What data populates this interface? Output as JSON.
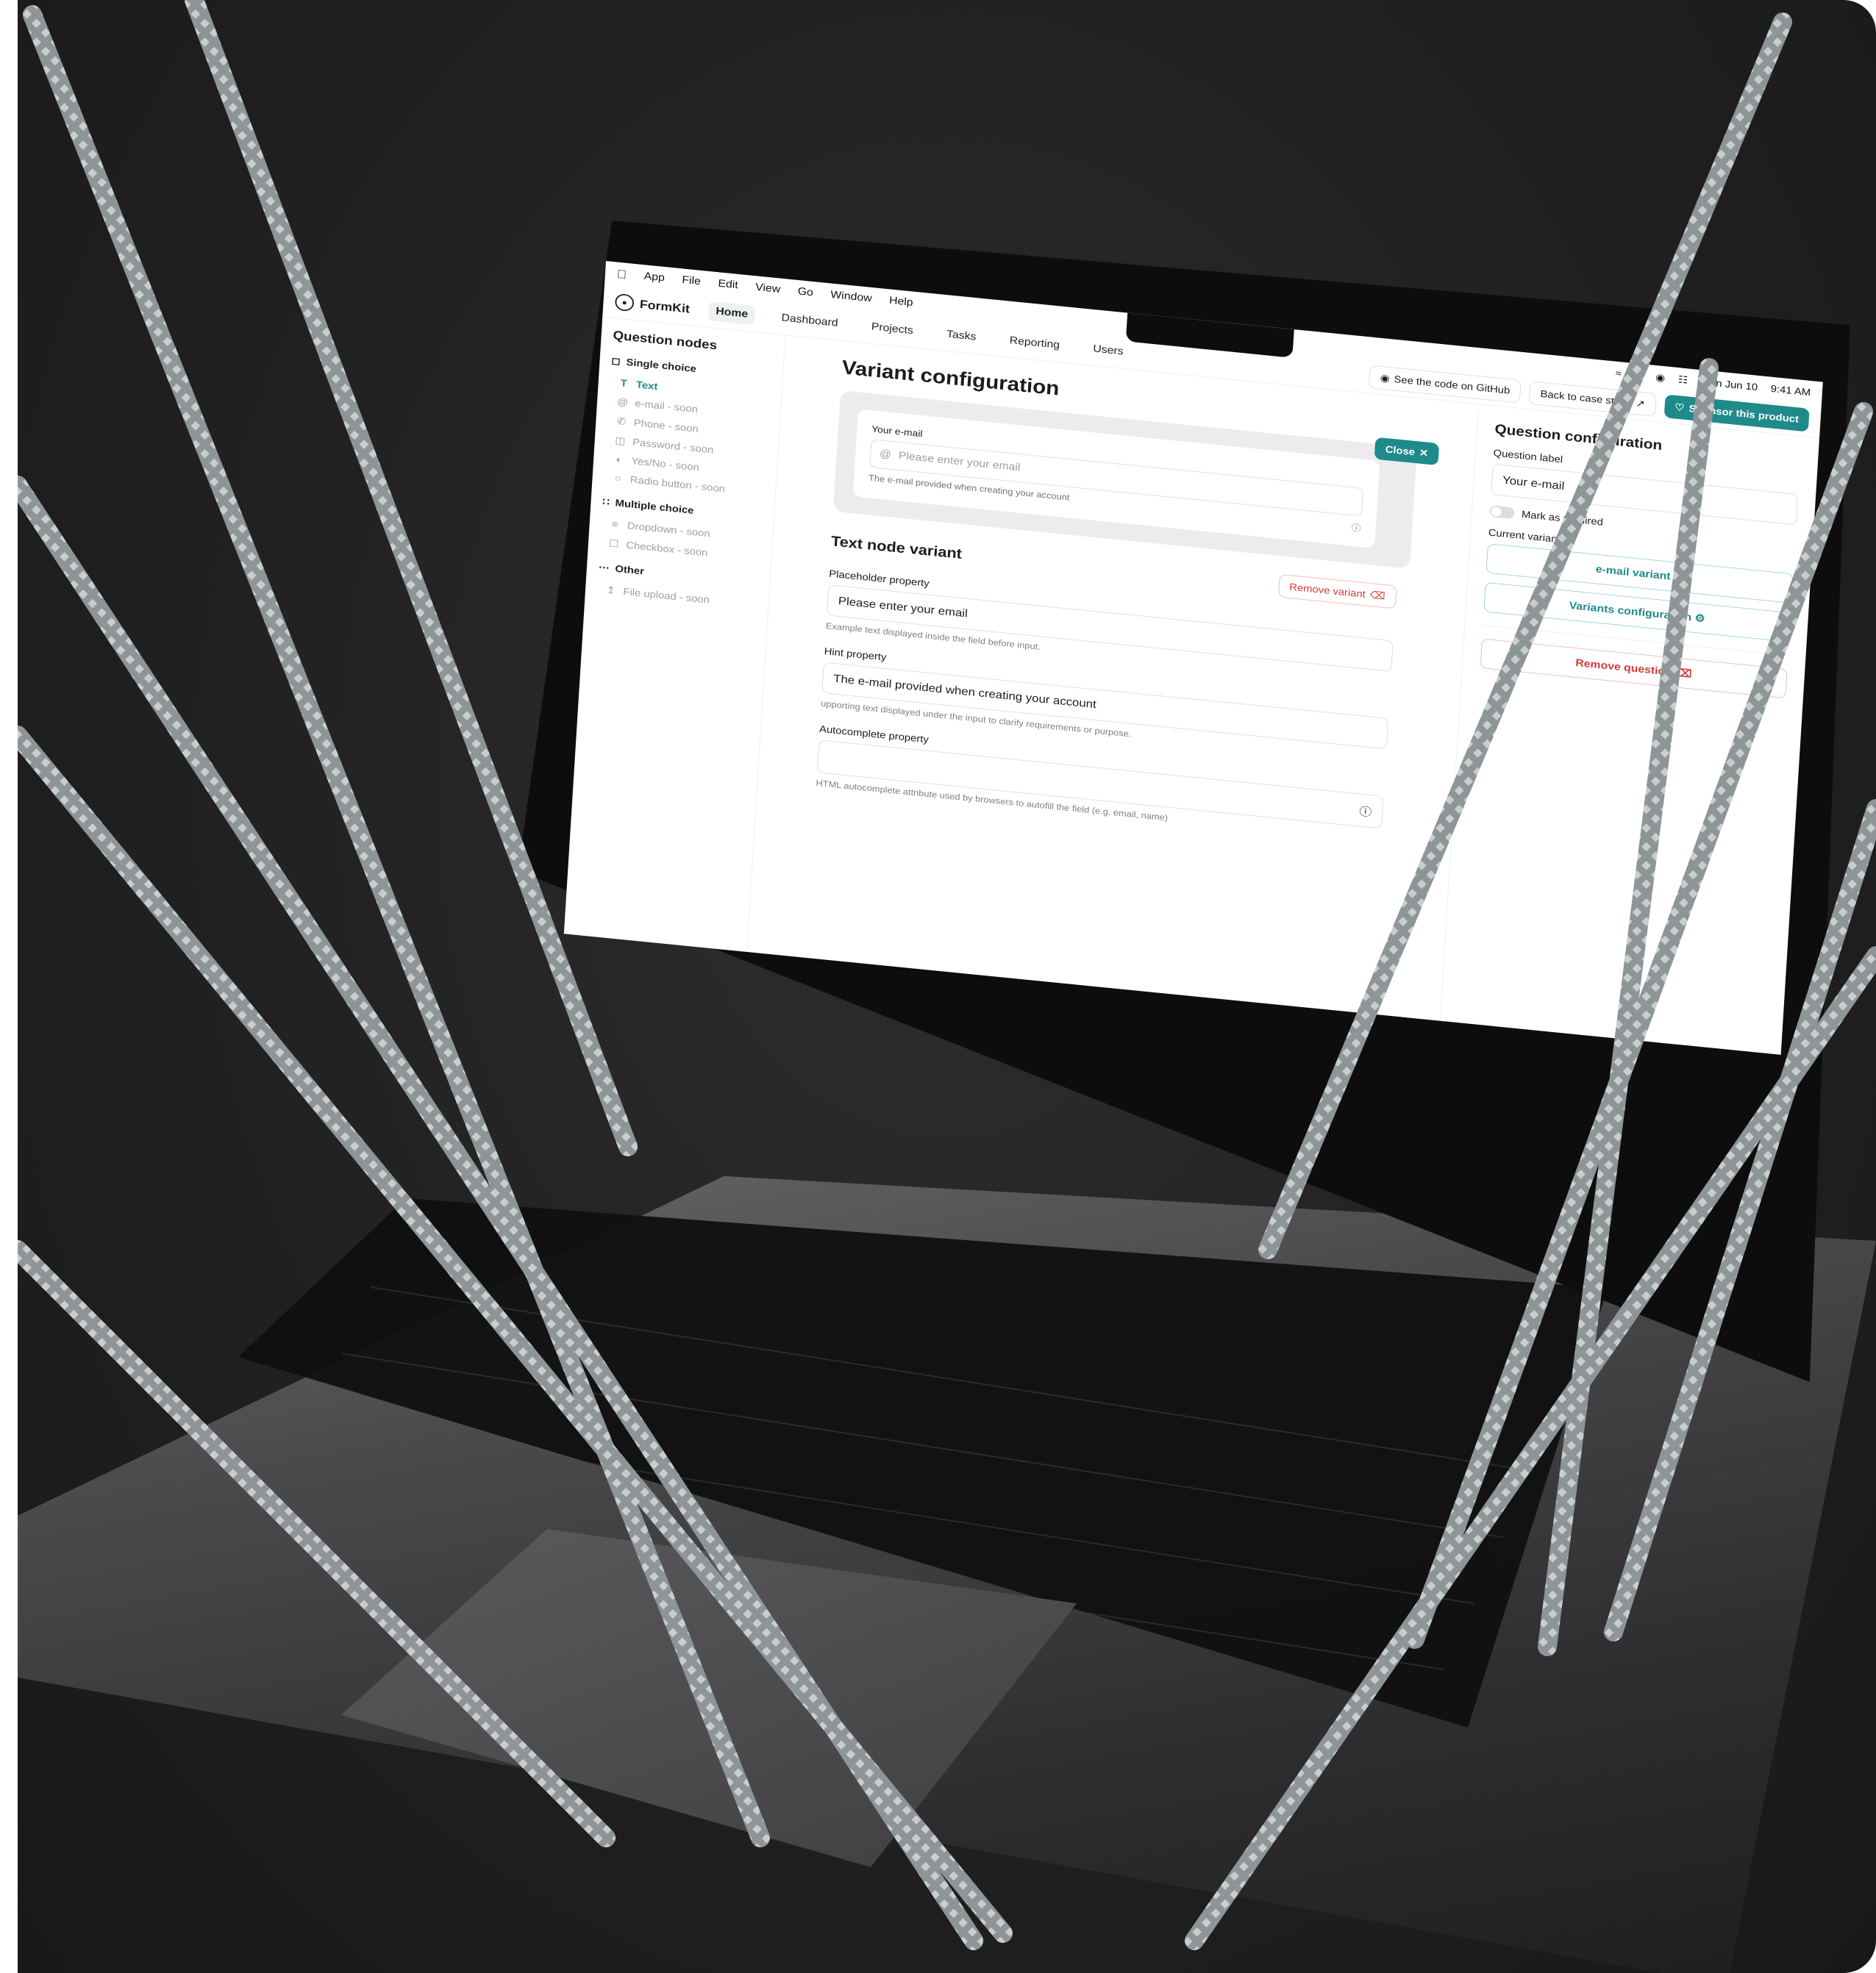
{
  "menubar": {
    "apple_icon": "apple-logo-icon",
    "items": [
      "App",
      "File",
      "Edit",
      "View",
      "Go",
      "Window",
      "Help"
    ],
    "status_icons": [
      "wifi-icon",
      "search-icon",
      "user-icon",
      "control-center-icon"
    ],
    "date": "Mon Jun 10",
    "time": "9:41 AM"
  },
  "topnav": {
    "brand": "FormKit",
    "items": [
      "Home",
      "Dashboard",
      "Projects",
      "Tasks",
      "Reporting",
      "Users"
    ],
    "active": "Home",
    "github_label": "See the code on GitHub",
    "case_study_label": "Back to case study",
    "sponsor_label": "Sponsor this product"
  },
  "sidebar": {
    "title": "Question nodes",
    "single_choice": "Single choice",
    "single_items": [
      "Text",
      "e-mail - soon",
      "Phone - soon",
      "Password - soon",
      "Yes/No - soon",
      "Radio button - soon"
    ],
    "multiple_choice": "Multiple choice",
    "multiple_items": [
      "Dropdown - soon",
      "Checkbox - soon"
    ],
    "other": "Other",
    "other_items": [
      "File upload - soon"
    ]
  },
  "main": {
    "title": "Variant configuration",
    "close_label": "Close",
    "preview": {
      "label": "Your e-mail",
      "placeholder": "Please enter your email",
      "hint": "The e-mail provided when creating your account"
    },
    "variant_title": "Text node variant",
    "remove_variant_label": "Remove variant",
    "placeholder_prop": {
      "label": "Placeholder property",
      "value": "Please enter your email",
      "desc": "Example text displayed inside the field before input."
    },
    "hint_prop": {
      "label": "Hint property",
      "value": "The e-mail provided when creating your account",
      "desc": "upporting text displayed under the input to clarify requirements or purpose."
    },
    "autocomplete_prop": {
      "label": "Autocomplete property",
      "value": "",
      "desc": "HTML autocomplete attribute used by browsers to autofill the field (e.g. email, name)"
    }
  },
  "right": {
    "title": "Question configuration",
    "question_label": "Question label",
    "question_value": "Your e-mail",
    "required_label": "Mark as required",
    "current_variant_label": "Current variant",
    "current_variant_value": "e-mail variant",
    "variants_config_label": "Variants configuration",
    "remove_question_label": "Remove question"
  },
  "colors": {
    "accent": "#1f8a8a",
    "danger": "#d33b3b",
    "background": "#1e1e1f"
  }
}
